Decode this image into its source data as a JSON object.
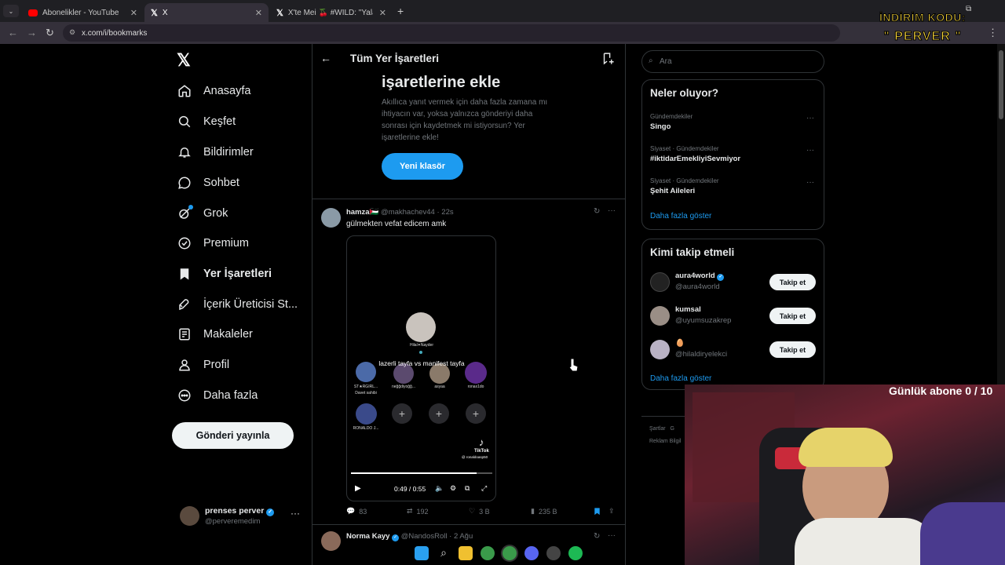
{
  "browser": {
    "tabs": [
      {
        "title": "Abonelikler - YouTube"
      },
      {
        "title": "X"
      },
      {
        "title": "X'te Mei 🍒 #WILD: \"Yalan yanı"
      }
    ],
    "url": "x.com/i/bookmarks"
  },
  "nav": {
    "items": [
      {
        "label": "Anasayfa",
        "icon": "home-icon"
      },
      {
        "label": "Keşfet",
        "icon": "search-icon"
      },
      {
        "label": "Bildirimler",
        "icon": "bell-icon"
      },
      {
        "label": "Sohbet",
        "icon": "chat-icon"
      },
      {
        "label": "Grok",
        "icon": "grok-icon"
      },
      {
        "label": "Premium",
        "icon": "verified-icon"
      },
      {
        "label": "Yer İşaretleri",
        "icon": "bookmark-icon"
      },
      {
        "label": "İçerik Üreticisi St...",
        "icon": "rocket-icon"
      },
      {
        "label": "Makaleler",
        "icon": "article-icon"
      },
      {
        "label": "Profil",
        "icon": "profile-icon"
      },
      {
        "label": "Daha fazla",
        "icon": "more-circle-icon"
      }
    ],
    "post_button": "Gönderi yayınla",
    "account": {
      "name": "prenses perver",
      "handle": "@perveremedim"
    }
  },
  "main": {
    "header_title": "Tüm Yer İşaretleri",
    "promo": {
      "title": "işaretlerine ekle",
      "text": "Akıllıca yanıt vermek için daha fazla zamana mı ihtiyacın var, yoksa yalnızca gönderiyi daha sonrası için kaydetmek mi istiyorsun? Yer işaretlerine ekle!",
      "button": "Yeni klasör"
    },
    "tweet1": {
      "name": "hamza🇵🇸",
      "handle": "@makhachev44",
      "time": "· 22s",
      "text": "gülmekten vefat edicem amk",
      "video": {
        "center_user": "Hilal✦Nayder",
        "overlay_text": "lazerli tayfa vs manifest tayfa",
        "users": [
          "ST★RGIRL...",
          "neğğdiyoğğ...",
          "asyaa",
          "ronax1do"
        ],
        "sub_label": "Davet sahibi",
        "user5": "RONALDO J...",
        "watermark": "TikTok",
        "watermark_handle": "@ ronaldoasp50",
        "time": "0:49 / 0:55",
        "progress": 0.89
      },
      "replies": "83",
      "reposts": "192",
      "likes": "3 B",
      "views": "235 B"
    },
    "tweet2": {
      "name": "Norma Kayy",
      "handle": "@NandosRoll",
      "time": "· 2 Ağu"
    }
  },
  "right": {
    "search_placeholder": "Ara",
    "trends": {
      "title": "Neler oluyor?",
      "items": [
        {
          "meta": "Gündemdekiler",
          "name": "Singo"
        },
        {
          "meta": "Siyaset · Gündemdekiler",
          "name": "#iktidarEmekliyiSevmiyor"
        },
        {
          "meta": "Siyaset · Gündemdekiler",
          "name": "Şehit Aileleri"
        }
      ],
      "show_more": "Daha fazla göster"
    },
    "follow": {
      "title": "Kimi takip etmeli",
      "items": [
        {
          "name": "aura4world",
          "handle": "@aura4world",
          "button": "Takip et"
        },
        {
          "name": "kumsal",
          "handle": "@uyumsuzakrep",
          "button": "Takip et"
        },
        {
          "name": "🥚",
          "handle": "@hilaldiryelekci",
          "button": "Takip et"
        }
      ],
      "show_more": "Daha fazla göster"
    },
    "footer": "Şartlar   G",
    "footer2": "Reklam Bilgil"
  },
  "overlay": {
    "promo_line1": "İNDİRİM KODU:",
    "promo_line2": "\" PERVER \"",
    "sub_counter": "Günlük abone 0 / 10"
  },
  "colors": {
    "accent": "#1d9bf0",
    "background": "#000000",
    "border": "#2f3336"
  }
}
